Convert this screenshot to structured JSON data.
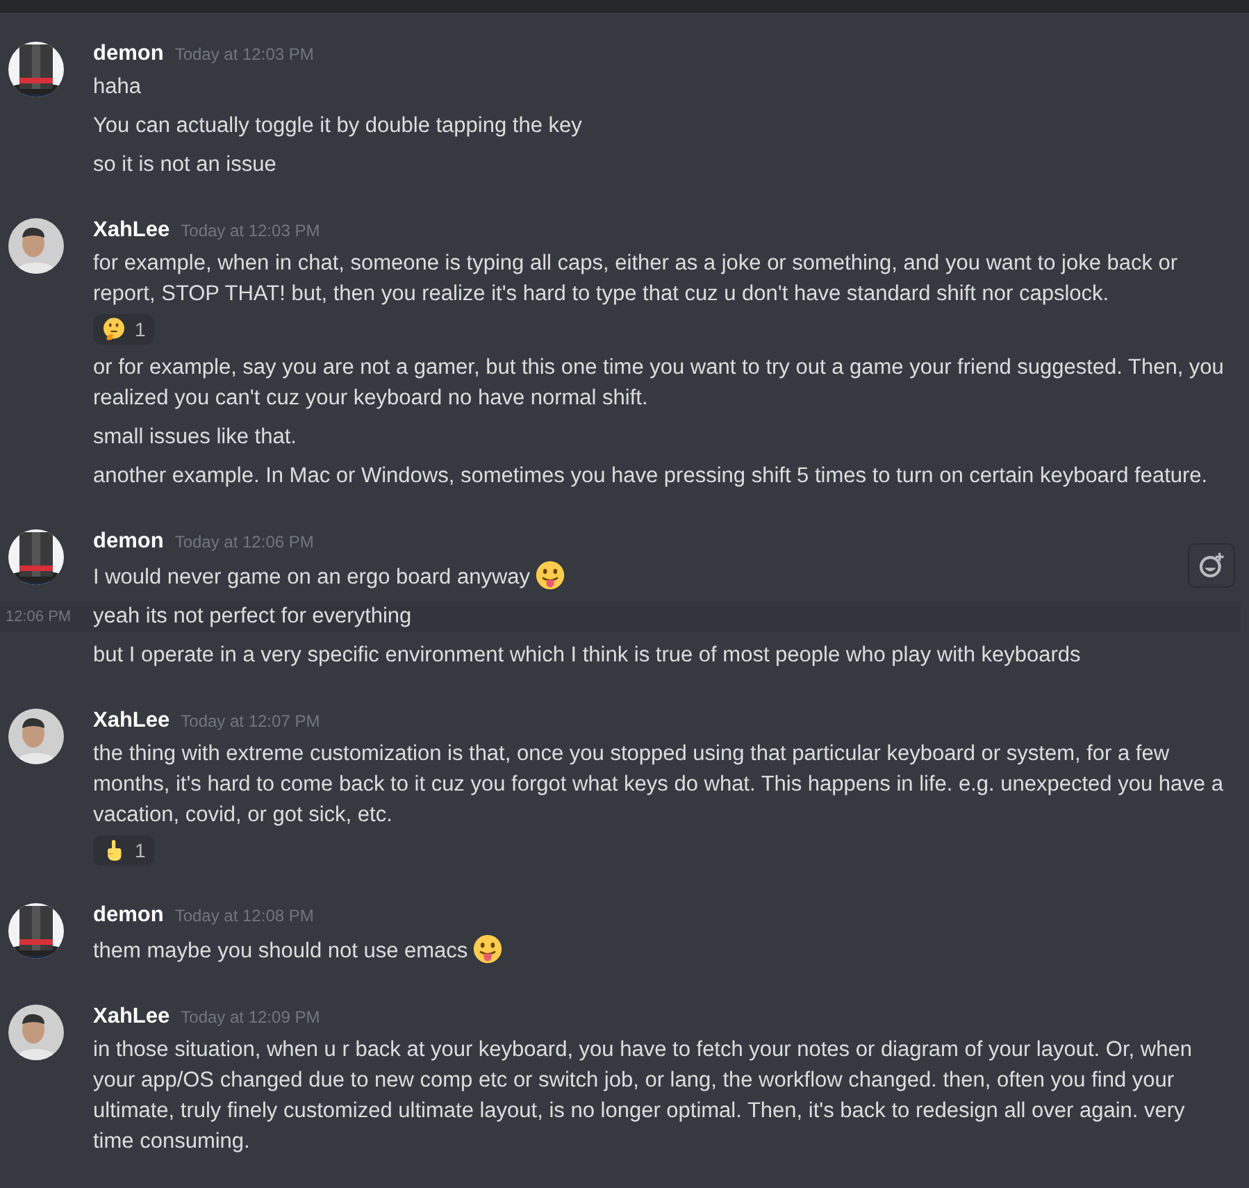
{
  "messages": [
    {
      "author": "demon",
      "kind": "hat",
      "timestamp": "Today at 12:03 PM",
      "lines": [
        {
          "text": "haha"
        },
        {
          "text": "You can actually toggle it by double tapping the key"
        },
        {
          "text": "so it is not an issue"
        }
      ]
    },
    {
      "author": "XahLee",
      "kind": "person",
      "timestamp": "Today at 12:03 PM",
      "lines": [
        {
          "text": "for example, when in chat, someone is typing all caps, either as a joke or something, and you want to joke back or report, STOP THAT! but, then you realize it's hard to type that cuz u don't have standard shift nor capslock.",
          "reactions": [
            {
              "kind": "thinking",
              "count": "1"
            }
          ]
        },
        {
          "text": "or for example, say you are not a gamer, but this one time you want to try out a game your friend suggested. Then, you realized you can't cuz your keyboard no have normal shift."
        },
        {
          "text": "small issues like that."
        },
        {
          "text": "another example. In Mac or Windows, sometimes you have pressing shift 5 times to turn on certain keyboard feature."
        }
      ]
    },
    {
      "author": "demon",
      "kind": "hat",
      "timestamp": "Today at 12:06 PM",
      "lines": [
        {
          "text": "I would never game on an ergo board anyway",
          "emoji": true
        },
        {
          "text": "yeah its not perfect for everything",
          "hovered": true,
          "hover_time": "12:06 PM"
        },
        {
          "text": "but I operate in a very specific environment which I think is true of most people who play with keyboards"
        }
      ]
    },
    {
      "author": "XahLee",
      "kind": "person",
      "timestamp": "Today at 12:07 PM",
      "lines": [
        {
          "text": "the thing with extreme customization is that, once you stopped using that particular keyboard or system, for a few months, it's hard to come back to it cuz you forgot what keys do what. This happens in life. e.g. unexpected you have a vacation, covid, or got sick, etc.",
          "reactions": [
            {
              "kind": "pointing",
              "count": "1"
            }
          ]
        }
      ]
    },
    {
      "author": "demon",
      "kind": "hat",
      "timestamp": "Today at 12:08 PM",
      "lines": [
        {
          "text": "them maybe you should not use emacs",
          "emoji": true
        }
      ]
    },
    {
      "author": "XahLee",
      "kind": "person",
      "timestamp": "Today at 12:09 PM",
      "lines": [
        {
          "text": "in those situation, when u r back at your keyboard, you have to fetch your notes or diagram of your layout. Or, when your app/OS changed due to new comp etc or switch job, or lang, the workflow changed. then, often you find your ultimate, truly finely customized ultimate layout, is no longer optimal. Then, it's back to redesign all over again. very time consuming."
        }
      ]
    }
  ]
}
